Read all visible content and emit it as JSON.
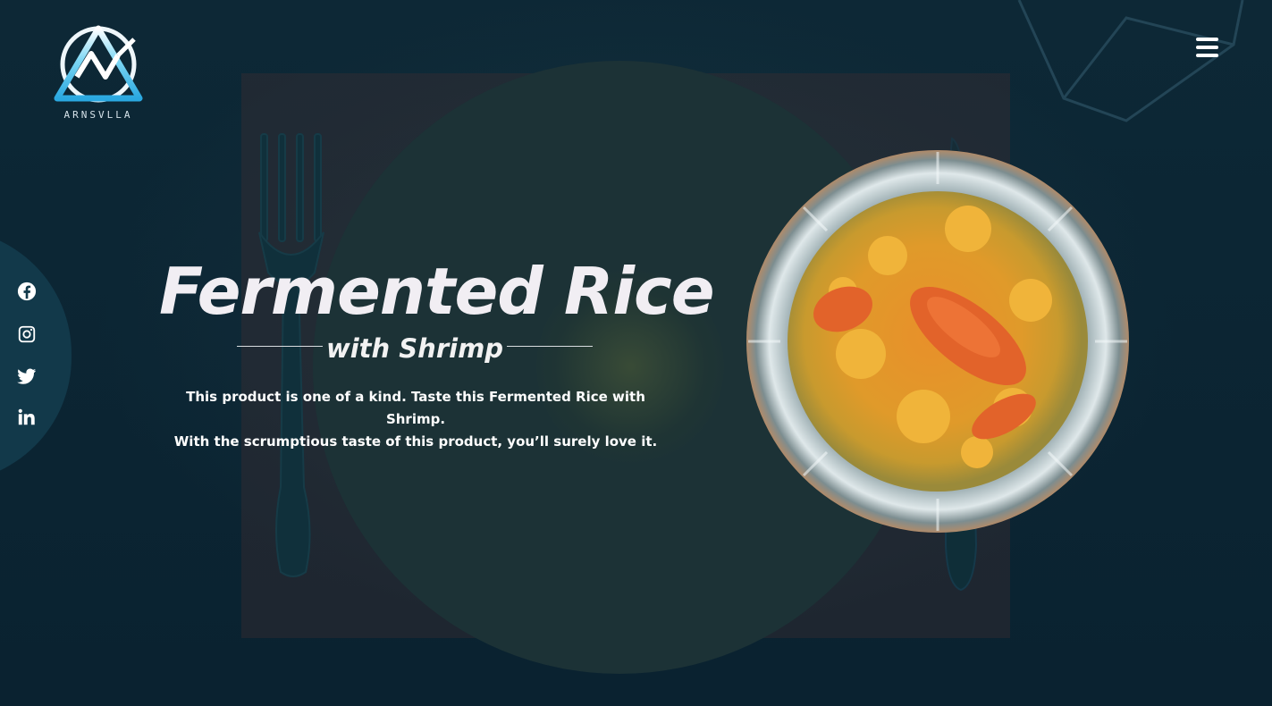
{
  "brand": {
    "name": "ARNSVLLA"
  },
  "hero": {
    "title": "Fermented Rice",
    "subtitle": "with Shrimp",
    "description_line1": "This product is one of a kind. Taste this Fermented Rice with Shrimp.",
    "description_line2": "With the scrumptious taste of this product, you’ll surely love it."
  },
  "social": [
    {
      "icon": "facebook-icon"
    },
    {
      "icon": "instagram-icon"
    },
    {
      "icon": "twitter-icon"
    },
    {
      "icon": "linkedin-icon"
    }
  ],
  "nav": {
    "menu_icon": "hamburger-menu-icon"
  },
  "colors": {
    "background": "#0b2431",
    "plate": "#1c3236",
    "side_panel": "#12394a",
    "logo_accent": "#3cc6f0",
    "text": "#ffffff"
  }
}
